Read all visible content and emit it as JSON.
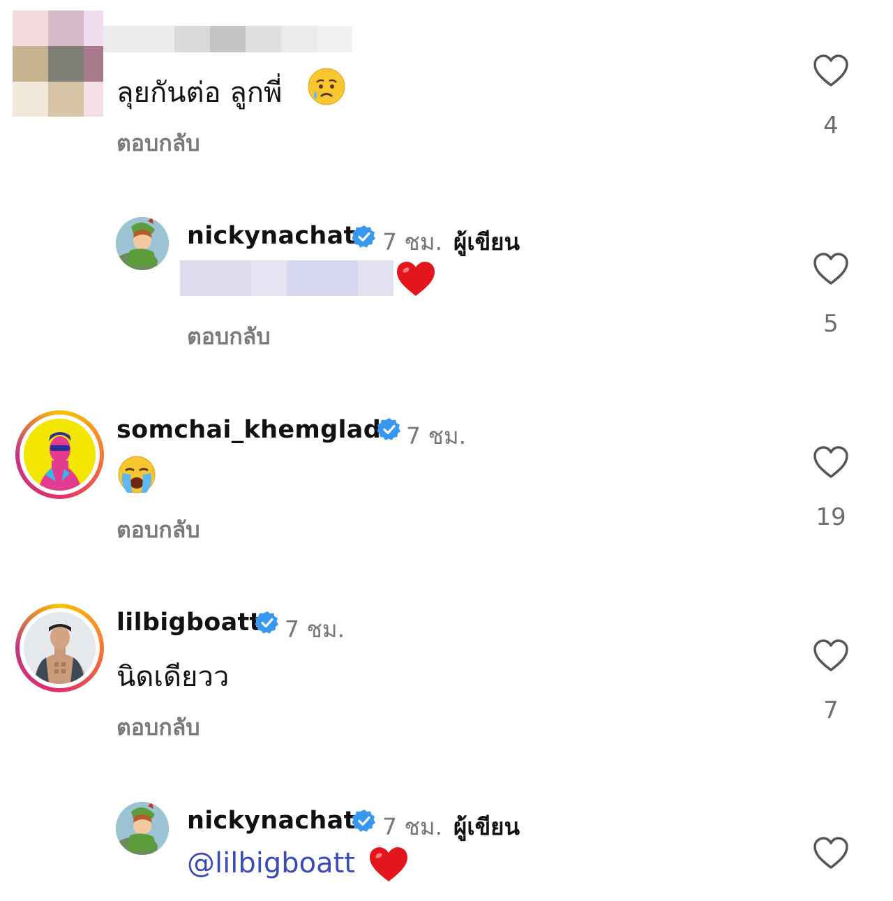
{
  "comments": [
    {
      "username": "",
      "time": "",
      "author_label": "",
      "text": "ลุยกันต่อ ลูกพี่",
      "emoji": "crying-face",
      "reply_label": "ตอบกลับ",
      "likes": "4"
    },
    {
      "username": "nickynachat",
      "verified": true,
      "time": "7 ชม.",
      "author_label": "ผู้เขียน",
      "text": "",
      "emoji": "red-heart",
      "reply_label": "ตอบกลับ",
      "likes": "5"
    },
    {
      "username": "somchai_khemglad",
      "verified": true,
      "time": "7 ชม.",
      "text": "",
      "emoji": "loudly-crying-face",
      "reply_label": "ตอบกลับ",
      "likes": "19"
    },
    {
      "username": "lilbigboatt",
      "verified": true,
      "time": "7 ชม.",
      "text": "นิดเดียวว",
      "reply_label": "ตอบกลับ",
      "likes": "7"
    },
    {
      "username": "nickynachat",
      "verified": true,
      "time": "7 ชม.",
      "author_label": "ผู้เขียน",
      "mention": "@lilbigboatt",
      "emoji": "red-heart"
    }
  ],
  "colors": {
    "verified": "#3897f0",
    "mention": "#3b4bb8",
    "reply": "#7a7a7a",
    "time": "#777777"
  }
}
